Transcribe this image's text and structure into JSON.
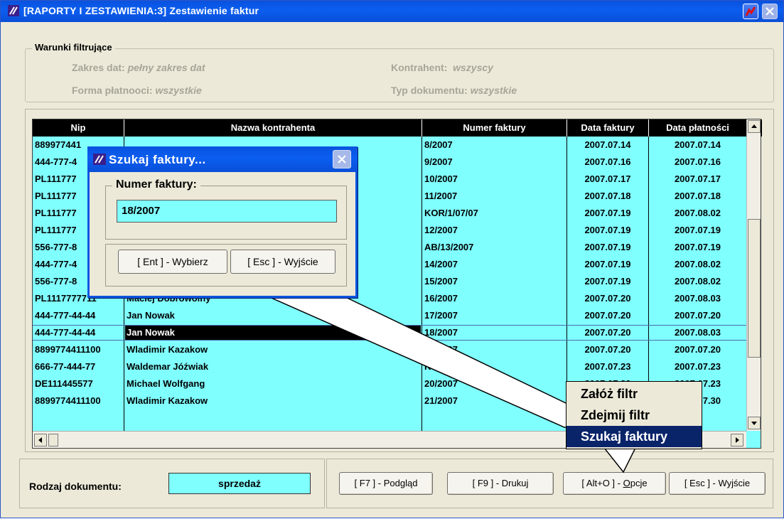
{
  "window": {
    "title": "[RAPORTY I ZESTAWIENIA:3]  Zestawienie faktur"
  },
  "filters": {
    "legend": "Warunki filtrujące",
    "date_range_label": "Zakres dat:",
    "date_range_value": "pełny zakres dat",
    "contractor_label": "Kontrahent:",
    "contractor_value": "wszyscy",
    "payment_label": "Forma płatnooci:",
    "payment_value": "wszystkie",
    "doc_type_label": "Typ dokumentu:",
    "doc_type_value": "wszystkie"
  },
  "table": {
    "columns": [
      "Nip",
      "Nazwa kontrahenta",
      "Numer faktury",
      "Data faktury",
      "Data płatności"
    ],
    "rows": [
      {
        "nip": "889977441",
        "name": "",
        "invoice": "8/2007",
        "date": "2007.07.14",
        "due": "2007.07.14"
      },
      {
        "nip": "444-777-4",
        "name": "",
        "invoice": "9/2007",
        "date": "2007.07.16",
        "due": "2007.07.16"
      },
      {
        "nip": "PL111777",
        "name": "",
        "invoice": "10/2007",
        "date": "2007.07.17",
        "due": "2007.07.17"
      },
      {
        "nip": "PL111777",
        "name": "",
        "invoice": "11/2007",
        "date": "2007.07.18",
        "due": "2007.07.18"
      },
      {
        "nip": "PL111777",
        "name": "",
        "invoice": "KOR/1/07/07",
        "date": "2007.07.19",
        "due": "2007.08.02"
      },
      {
        "nip": "PL111777",
        "name": "",
        "invoice": "12/2007",
        "date": "2007.07.19",
        "due": "2007.07.19"
      },
      {
        "nip": "556-777-8",
        "name": "",
        "invoice": "AB/13/2007",
        "date": "2007.07.19",
        "due": "2007.07.19"
      },
      {
        "nip": "444-777-4",
        "name": "",
        "invoice": "14/2007",
        "date": "2007.07.19",
        "due": "2007.08.02"
      },
      {
        "nip": "556-777-8",
        "name": "",
        "invoice": "15/2007",
        "date": "2007.07.19",
        "due": "2007.08.02"
      },
      {
        "nip": "PL1117777711",
        "name": "Maciej Dobrowolny",
        "invoice": "16/2007",
        "date": "2007.07.20",
        "due": "2007.08.03"
      },
      {
        "nip": "444-777-44-44",
        "name": "Jan Nowak",
        "invoice": "17/2007",
        "date": "2007.07.20",
        "due": "2007.07.20"
      },
      {
        "nip": "444-777-44-44",
        "name": "Jan Nowak",
        "invoice": "18/2007",
        "date": "2007.07.20",
        "due": "2007.08.03"
      },
      {
        "nip": "8899774411100",
        "name": "Wladimir Kazakow",
        "invoice": "19/2007",
        "date": "2007.07.20",
        "due": "2007.07.20"
      },
      {
        "nip": "666-77-444-77",
        "name": "Waldemar Jóźwiak",
        "invoice": "KOR/2/07/07",
        "date": "2007.07.23",
        "due": "2007.07.23"
      },
      {
        "nip": "DE111445577",
        "name": "Michael Wolfgang",
        "invoice": "20/2007",
        "date": "2007.07.23",
        "due": "2007.07.23"
      },
      {
        "nip": "8899774411100",
        "name": "Wladimir Kazakow",
        "invoice": "21/2007",
        "date": "2007.07.30",
        "due": "2007.07.30"
      }
    ],
    "selected_row_index": 11
  },
  "bottom": {
    "doc_kind_label": "Rodzaj dokumentu:",
    "doc_kind_value": "sprzedaż",
    "preview_button": "[ F7 ] - Podgląd",
    "print_button": "[ F9 ] - Drukuj",
    "options_button_prefix": "[ Alt+O ] - ",
    "options_button_underlined": "O",
    "options_button_suffix": "pcje",
    "exit_button": "[ Esc ] - Wyjście"
  },
  "options_menu": {
    "items": [
      "Załóż filtr",
      "Zdejmij filtr",
      "Szukaj faktury"
    ],
    "highlighted_index": 2
  },
  "search_dialog": {
    "title": "Szukaj faktury...",
    "field_label": "Numer faktury:",
    "field_value": "18/2007",
    "select_button": "[ Ent ] - Wybierz",
    "exit_button": "[ Esc ] - Wyjście"
  },
  "colors": {
    "title_bar": "#0b5ef0",
    "grid_background": "#80ffff",
    "grid_header": "#000000",
    "window_face": "#ECE9D8",
    "menu_highlight": "#0a246a"
  }
}
